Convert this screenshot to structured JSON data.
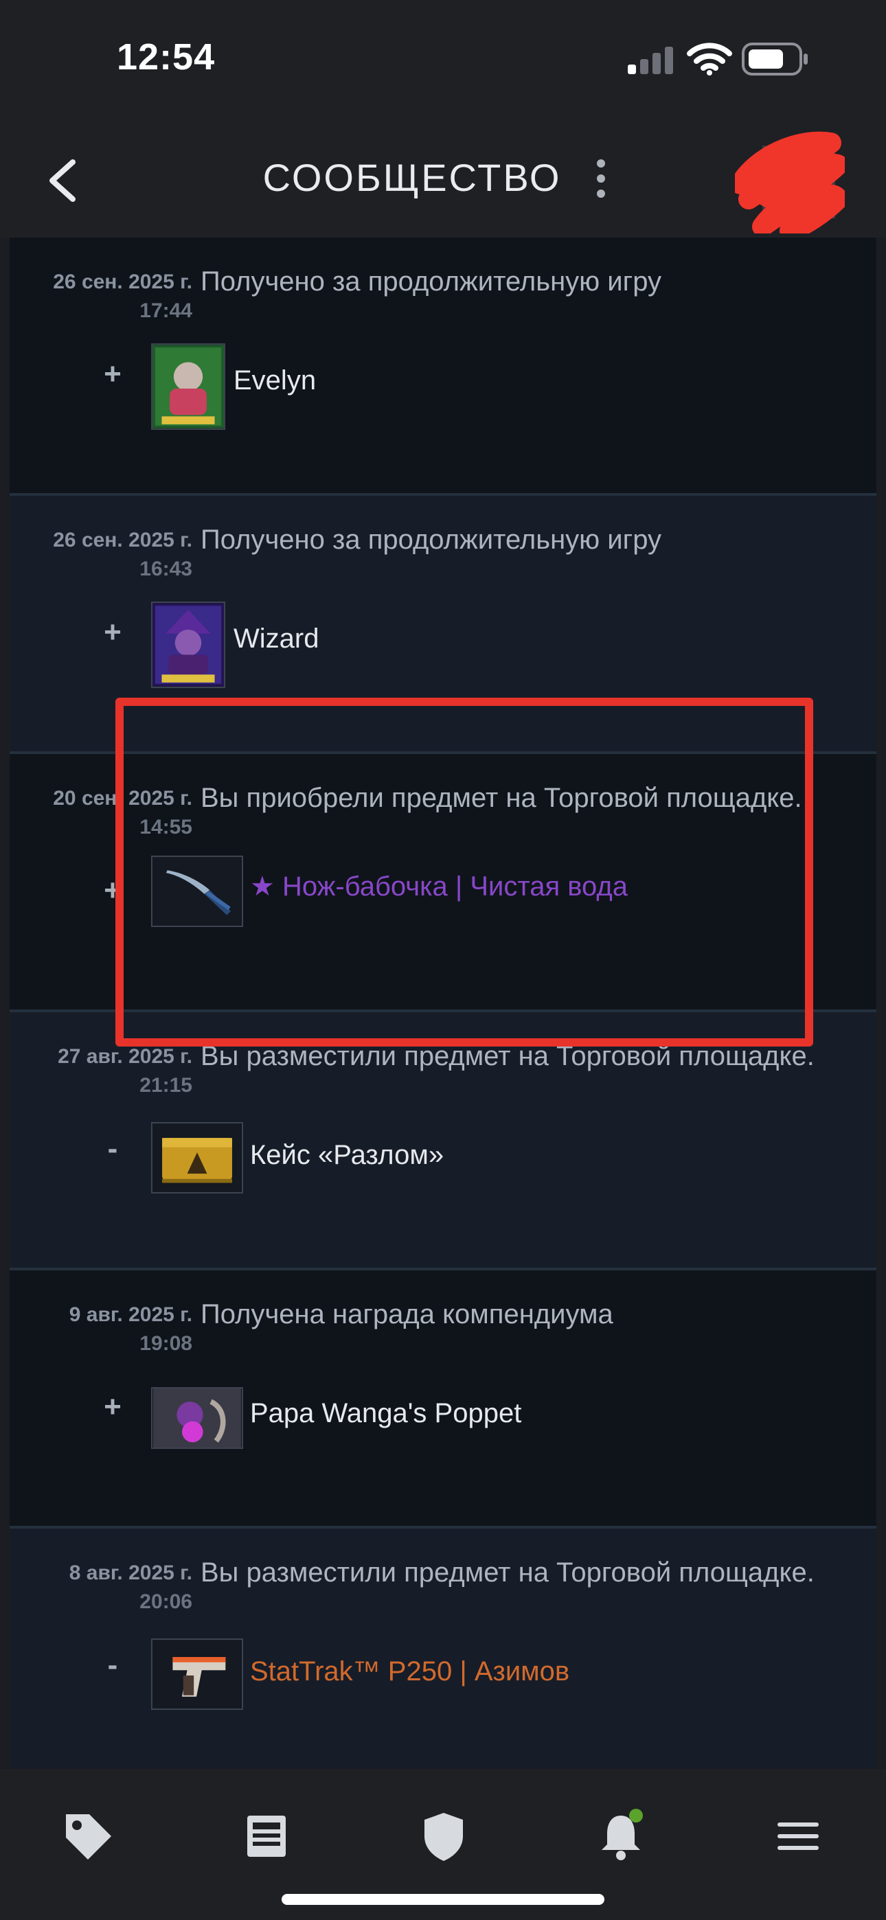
{
  "status": {
    "time": "12:54"
  },
  "header": {
    "title": "СООБЩЕСТВО"
  },
  "entries": [
    {
      "date": "26 сен. 2025 г.",
      "time": "17:44",
      "desc": "Получено за продолжительную игру",
      "sign": "+",
      "item": "Evelyn",
      "icon": "evelyn-portrait-icon"
    },
    {
      "date": "26 сен. 2025 г.",
      "time": "16:43",
      "desc": "Получено за продолжительную игру",
      "sign": "+",
      "item": "Wizard",
      "icon": "wizard-portrait-icon"
    },
    {
      "date": "20 сен. 2025 г.",
      "time": "14:55",
      "desc": "Вы приобрели предмет на Торговой площадке.",
      "sign": "+",
      "item": "★ Нож-бабочка | Чистая вода",
      "icon": "butterfly-knife-icon",
      "color": "#8847c8"
    },
    {
      "date": "27 авг. 2025 г.",
      "time": "21:15",
      "desc": "Вы разместили предмет на Торговой площадке.",
      "sign": "-",
      "item": "Кейс «Разлом»",
      "icon": "case-icon"
    },
    {
      "date": "9 авг. 2025 г.",
      "time": "19:08",
      "desc": "Получена награда компендиума",
      "sign": "+",
      "item": "Papa Wanga's Poppet",
      "icon": "poppet-icon"
    },
    {
      "date": "8 авг. 2025 г.",
      "time": "20:06",
      "desc": "Вы разместили предмет на Торговой площадке.",
      "sign": "-",
      "item": "StatTrak™ P250 | Азимов",
      "icon": "pistol-icon",
      "color": "#d26a2d"
    }
  ],
  "colors": {
    "accent_red": "#e8332b",
    "notification_dot": "#5ba32b"
  },
  "nav": [
    "tag-icon",
    "news-icon",
    "shield-icon",
    "bell-icon",
    "menu-icon"
  ]
}
